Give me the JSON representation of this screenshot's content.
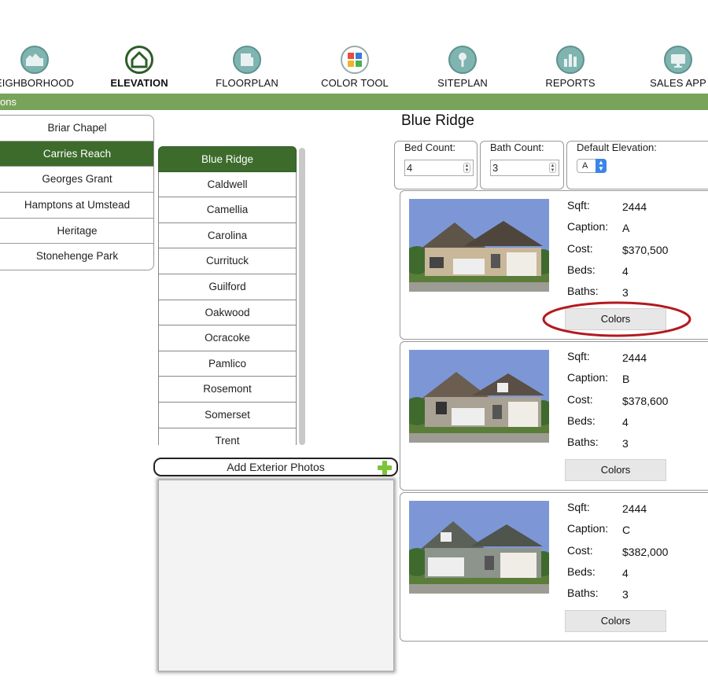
{
  "nav": {
    "items": [
      {
        "label": "EIGHBORHOOD",
        "icon": "neighborhood-icon"
      },
      {
        "label": "ELEVATION",
        "icon": "house-icon",
        "active": true
      },
      {
        "label": "FLOORPLAN",
        "icon": "floorplan-icon"
      },
      {
        "label": "COLOR TOOL",
        "icon": "color-palette-icon"
      },
      {
        "label": "SITEPLAN",
        "icon": "map-pin-icon"
      },
      {
        "label": "REPORTS",
        "icon": "bar-chart-icon"
      },
      {
        "label": "SALES APP",
        "icon": "monitor-icon"
      }
    ]
  },
  "section_bar": {
    "label": "ons"
  },
  "communities": [
    {
      "label": "Briar Chapel"
    },
    {
      "label": "Carries Reach",
      "selected": true
    },
    {
      "label": "Georges Grant"
    },
    {
      "label": "Hamptons at Umstead"
    },
    {
      "label": "Heritage"
    },
    {
      "label": "Stonehenge Park"
    }
  ],
  "plans": [
    {
      "label": "Blue Ridge",
      "selected": true
    },
    {
      "label": "Caldwell"
    },
    {
      "label": "Camellia"
    },
    {
      "label": "Carolina"
    },
    {
      "label": "Currituck"
    },
    {
      "label": "Guilford"
    },
    {
      "label": "Oakwood"
    },
    {
      "label": "Ocracoke"
    },
    {
      "label": "Pamlico"
    },
    {
      "label": "Rosemont"
    },
    {
      "label": "Somerset"
    },
    {
      "label": "Trent"
    }
  ],
  "add_photos": {
    "label": "Add Exterior Photos"
  },
  "plan_detail": {
    "title": "Blue Ridge",
    "bed_count": {
      "label": "Bed Count:",
      "value": "4"
    },
    "bath_count": {
      "label": "Bath Count:",
      "value": "3"
    },
    "default_elevation": {
      "label": "Default Elevation:",
      "value": "A"
    }
  },
  "spec_labels": {
    "sqft": "Sqft:",
    "caption": "Caption:",
    "cost": "Cost:",
    "beds": "Beds:",
    "baths": "Baths:"
  },
  "elevations": [
    {
      "sqft": "2444",
      "caption": "A",
      "cost": "$370,500",
      "beds": "4",
      "baths": "3",
      "button": "Colors"
    },
    {
      "sqft": "2444",
      "caption": "B",
      "cost": "$378,600",
      "beds": "4",
      "baths": "3",
      "button": "Colors"
    },
    {
      "sqft": "2444",
      "caption": "C",
      "cost": "$382,000",
      "beds": "4",
      "baths": "3",
      "button": "Colors"
    }
  ],
  "colors": {
    "accent_green": "#77a35a",
    "selected_green": "#3c6b2b",
    "highlight_red": "#b3191f"
  }
}
